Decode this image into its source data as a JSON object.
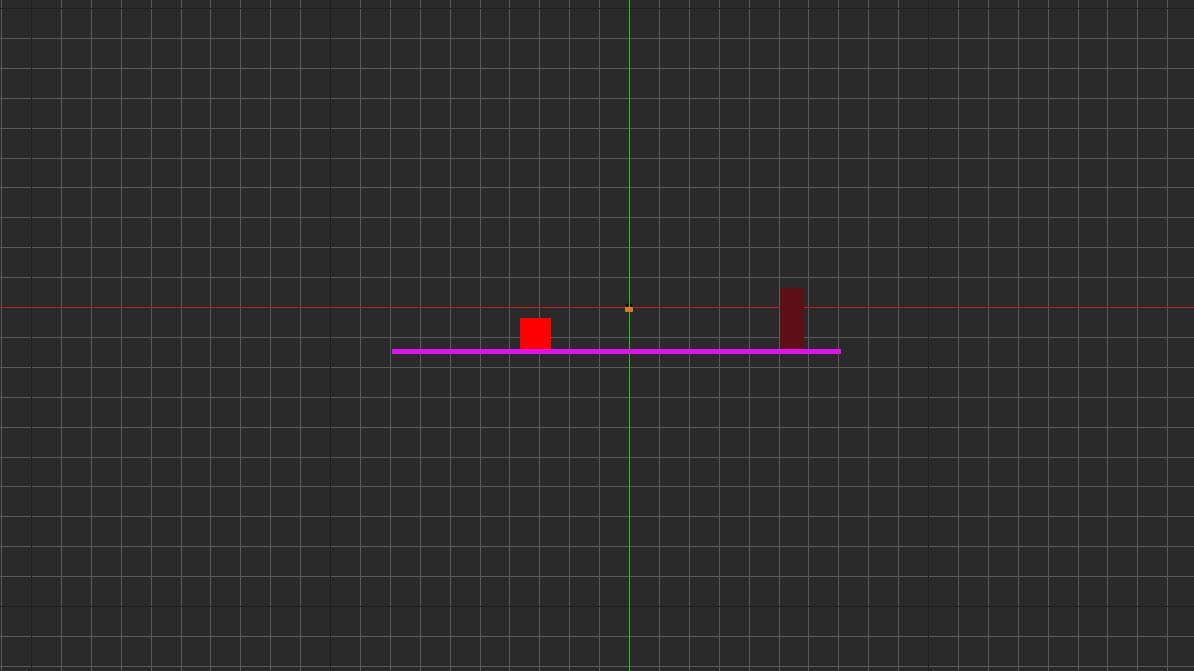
{
  "scene": {
    "background_color": "#2a2a2a",
    "minor_grid_color": "#5a5a5a",
    "major_grid_color": "#202020",
    "x_axis_color": "#c02020",
    "y_axis_color": "#20c020"
  },
  "entities": {
    "platform": {
      "color": "#e010f0"
    },
    "enemy": {
      "color": "#ff0000"
    },
    "goal": {
      "color": "#5c1015"
    },
    "player": {
      "body_color": "#e07820",
      "eye_color": "#000000"
    }
  }
}
